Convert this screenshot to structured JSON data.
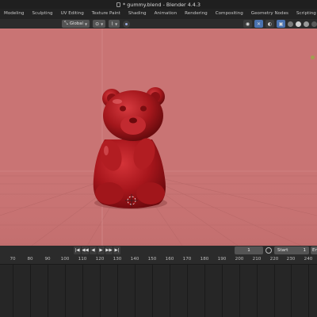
{
  "window": {
    "title": "* gummy.blend - Blender 4.4.3"
  },
  "workspace_tabs": [
    {
      "label": "Modeling",
      "active": false
    },
    {
      "label": "Sculpting",
      "active": false
    },
    {
      "label": "UV Editing",
      "active": false
    },
    {
      "label": "Texture Paint",
      "active": false
    },
    {
      "label": "Shading",
      "active": false
    },
    {
      "label": "Animation",
      "active": false
    },
    {
      "label": "Rendering",
      "active": false
    },
    {
      "label": "Compositing",
      "active": false
    },
    {
      "label": "Geometry Nodes",
      "active": false
    },
    {
      "label": "Scripting",
      "active": false
    }
  ],
  "tabs_add": "+",
  "viewport_header": {
    "orientation_label": "Global",
    "orientation_icon": "orientation-icon",
    "pivot_icon": "pivot-icon",
    "snap_icon": "snap-icon",
    "proportional_icon": "proportional-icon",
    "right_icons": [
      "visibility-icon",
      "gizmo-icon",
      "overlay-icon",
      "xray-icon"
    ],
    "shading_colors": [
      "#7a7a7a",
      "#cfcfcf",
      "#9a9a9a",
      "#5a5a5a"
    ]
  },
  "viewport": {
    "background_color": "#c97474",
    "object": "gummy bear",
    "object_color": "#9a1418"
  },
  "timeline": {
    "playback_buttons": [
      "|◀",
      "◀◀",
      "◀",
      "▶",
      "▶▶",
      "▶|"
    ],
    "current_frame": "1",
    "start_label": "Start",
    "start_value": "1",
    "end_label": "En",
    "ruler_ticks": [
      "70",
      "80",
      "90",
      "100",
      "110",
      "120",
      "130",
      "140",
      "150",
      "160",
      "170",
      "180",
      "190",
      "200",
      "210",
      "220",
      "230",
      "240"
    ]
  }
}
